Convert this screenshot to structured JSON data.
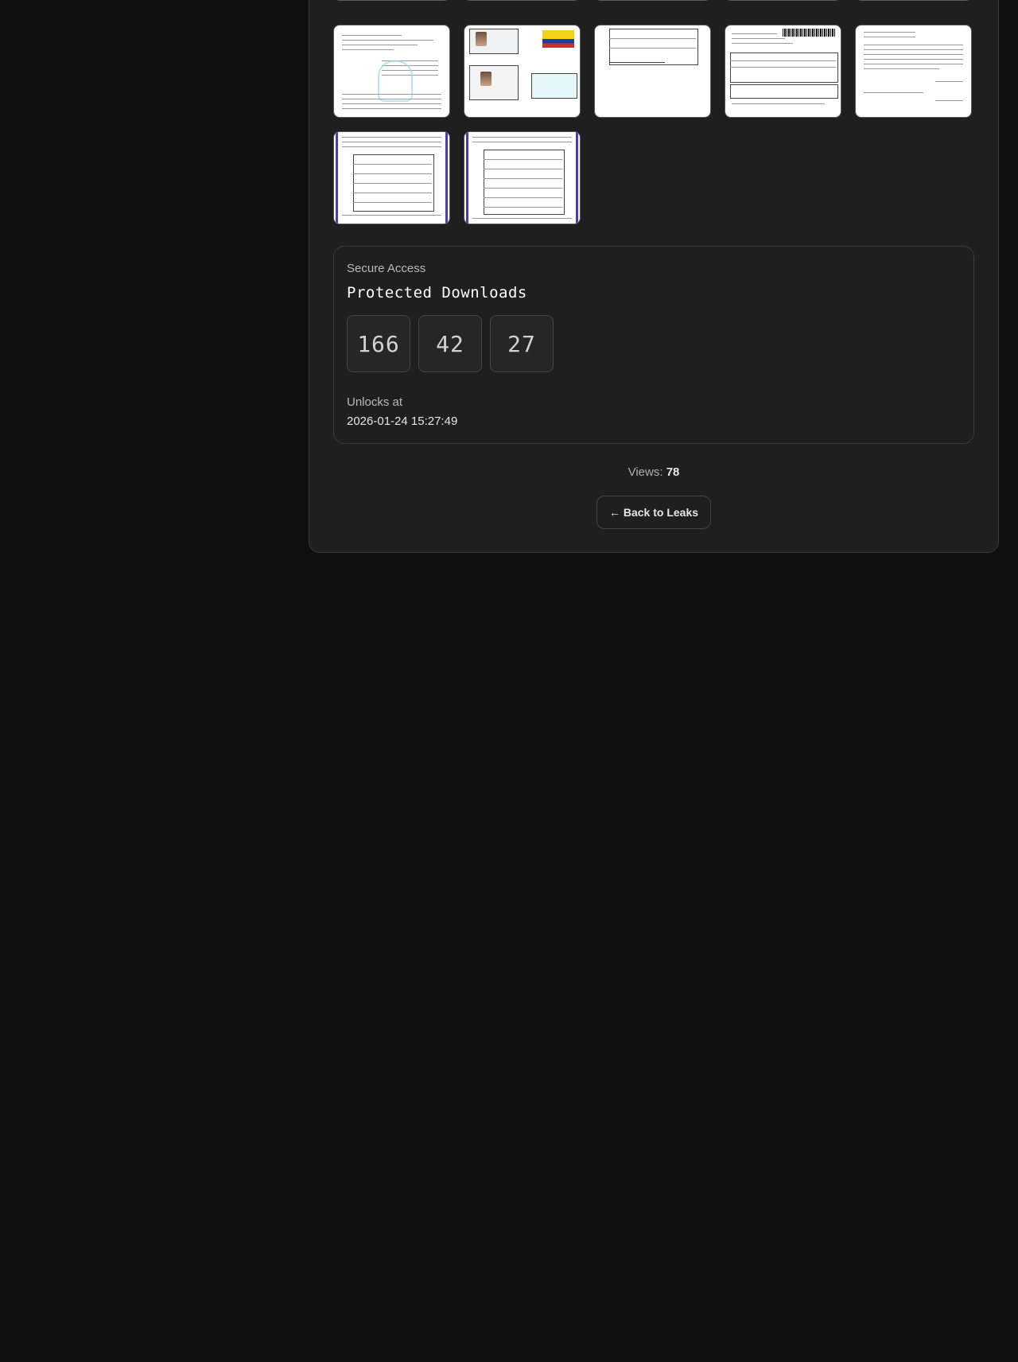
{
  "gallery": {
    "thumbnails": [
      {
        "row": 0,
        "col": 0,
        "name": "document-thumbnail-ticket"
      },
      {
        "row": 0,
        "col": 1,
        "name": "document-thumbnail-id-mrz"
      },
      {
        "row": 0,
        "col": 2,
        "name": "document-thumbnail-form"
      },
      {
        "row": 0,
        "col": 3,
        "name": "document-thumbnail-blank"
      },
      {
        "row": 0,
        "col": 4,
        "name": "document-thumbnail-letter"
      },
      {
        "row": 1,
        "col": 0,
        "name": "document-thumbnail-receipt"
      },
      {
        "row": 1,
        "col": 1,
        "name": "document-thumbnail-id-cards"
      },
      {
        "row": 1,
        "col": 2,
        "name": "document-thumbnail-table"
      },
      {
        "row": 1,
        "col": 3,
        "name": "document-thumbnail-invoice"
      },
      {
        "row": 1,
        "col": 4,
        "name": "document-thumbnail-typed-letter"
      },
      {
        "row": 2,
        "col": 0,
        "name": "document-thumbnail-record"
      },
      {
        "row": 2,
        "col": 1,
        "name": "document-thumbnail-record-2"
      }
    ]
  },
  "secure": {
    "label": "Secure Access",
    "title": "Protected Downloads",
    "counters": [
      "166",
      "42",
      "27"
    ],
    "unlock_label": "Unlocks at",
    "unlock_value": "2026-01-24 15:27:49"
  },
  "views": {
    "label": "Views: ",
    "count": "78"
  },
  "back_button": {
    "label": "← Back to Leaks"
  },
  "colors": {
    "background": "#0f0f0f",
    "panel": "#1f1f1f",
    "border": "#3a3a3a",
    "accent_stripe": "#4b4391"
  }
}
